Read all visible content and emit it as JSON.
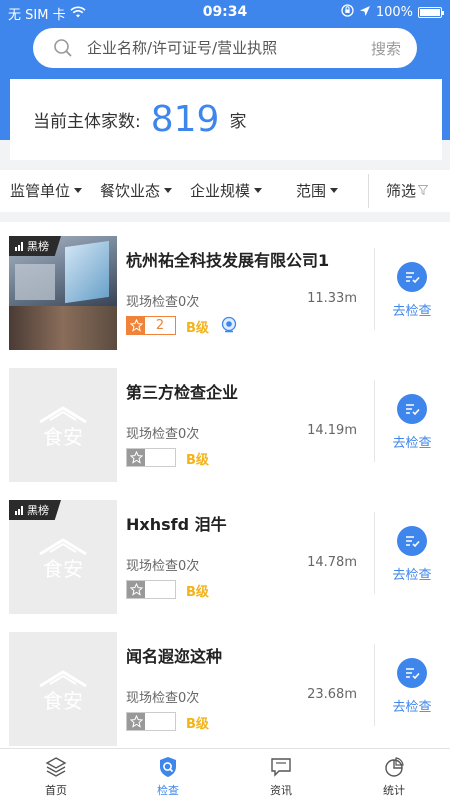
{
  "status_bar": {
    "carrier": "无 SIM 卡",
    "time": "09:34",
    "battery": "100%"
  },
  "search": {
    "placeholder": "企业名称/许可证号/营业执照",
    "button_label": "搜索"
  },
  "summary": {
    "label": "当前主体家数:",
    "count": "819",
    "unit": "家"
  },
  "filters": {
    "items": [
      {
        "label": "监管单位"
      },
      {
        "label": "餐饮业态"
      },
      {
        "label": "企业规模"
      },
      {
        "label": "范围"
      }
    ],
    "screen_label": "筛选"
  },
  "list": {
    "items": [
      {
        "name": "杭州祐全科技发展有限公司1",
        "inspection": "现场检查0次",
        "distance": "11.33m",
        "stars": "2",
        "grade": "B级",
        "badge": "黑榜",
        "action": "去检查"
      },
      {
        "name": "第三方检查企业",
        "inspection": "现场检查0次",
        "distance": "14.19m",
        "stars": "",
        "grade": "B级",
        "badge": "",
        "action": "去检查"
      },
      {
        "name": "Hxhsfd 泪牛",
        "inspection": "现场检查0次",
        "distance": "14.78m",
        "stars": "",
        "grade": "B级",
        "badge": "黑榜",
        "action": "去检查"
      },
      {
        "name": "闻名遐迩这种",
        "inspection": "现场检查0次",
        "distance": "23.68m",
        "stars": "",
        "grade": "B级",
        "badge": "",
        "action": "去检查"
      }
    ]
  },
  "tabbar": {
    "tabs": [
      {
        "label": "首页",
        "icon": "layers-icon"
      },
      {
        "label": "检查",
        "icon": "shield-search-icon"
      },
      {
        "label": "资讯",
        "icon": "chat-icon"
      },
      {
        "label": "统计",
        "icon": "pie-chart-icon"
      }
    ],
    "active": "检查"
  },
  "colors": {
    "primary": "#3f86ec",
    "orange": "#f0823a",
    "grade": "#f2b31b"
  }
}
